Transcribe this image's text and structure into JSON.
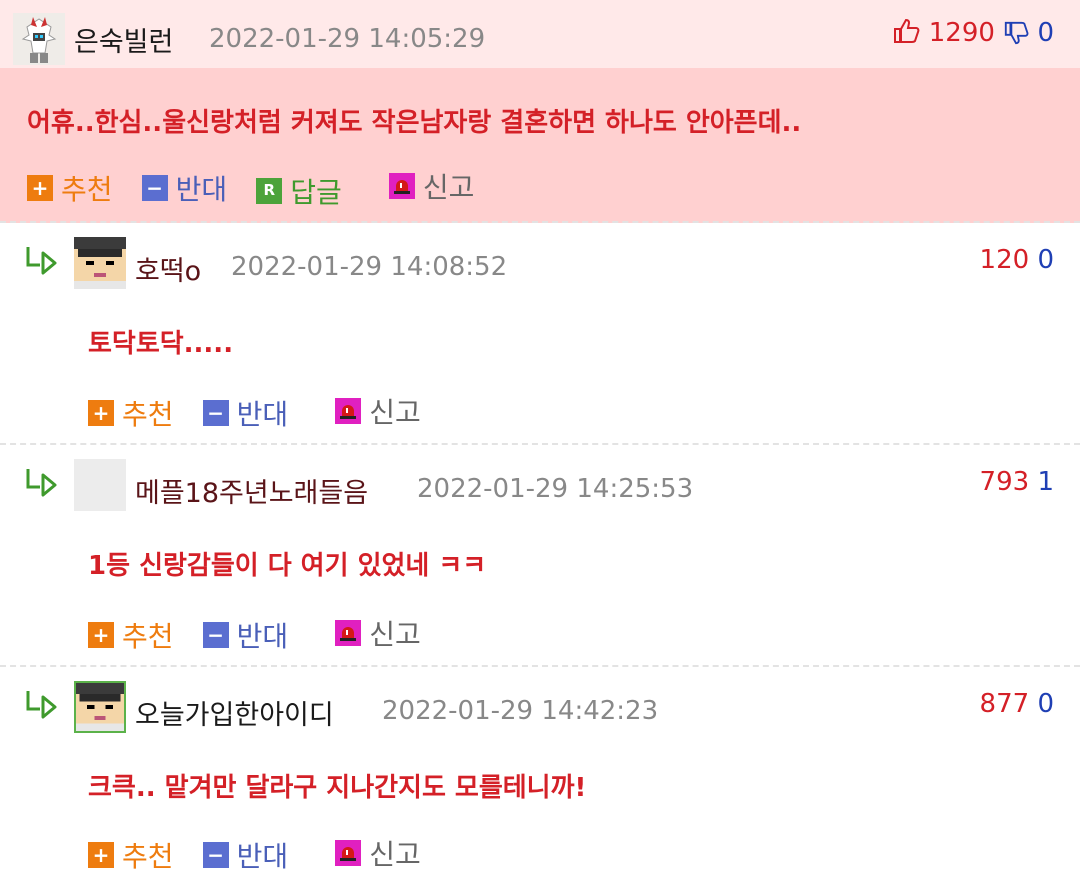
{
  "colors": {
    "best_bg": "#ffd0d0",
    "best_head_bg": "#ffe9e9",
    "comment_text": "#d42027",
    "vote_up": "#d42027",
    "vote_down": "#1f3fb4",
    "recommend": "#ee7c0f",
    "oppose": "#4a5fb8",
    "reply": "#3f9a2d"
  },
  "actions": {
    "recommend": "추천",
    "oppose": "반대",
    "reply": "답글",
    "report": "신고",
    "recommend_icon": "+",
    "oppose_icon": "−",
    "reply_icon": "R"
  },
  "comments": [
    {
      "avatar": "robot-avatar",
      "nickname": "은숙빌런",
      "date": "2022-01-29 14:05:29",
      "up": "1290",
      "down": "0",
      "text": "어휴..한심..울신랑처럼 커져도 작은남자랑 결혼하면 하나도 안아픈데.."
    },
    {
      "avatar": "pixel-boy-avatar",
      "nickname": "호떡o",
      "date": "2022-01-29 14:08:52",
      "up": "120",
      "down": "0",
      "text": "토닥토닥....."
    },
    {
      "avatar": "blank-avatar",
      "nickname": "메플18주년노래들음",
      "date": "2022-01-29 14:25:53",
      "up": "793",
      "down": "1",
      "text": "1등 신랑감들이 다 여기 있었네 ㅋㅋ"
    },
    {
      "avatar": "pixel-boy-avatar",
      "nickname": "오늘가입한아이디",
      "date": "2022-01-29 14:42:23",
      "up": "877",
      "down": "0",
      "text": "크큭.. 맡겨만 달라구 지나간지도 모를테니까!"
    }
  ]
}
